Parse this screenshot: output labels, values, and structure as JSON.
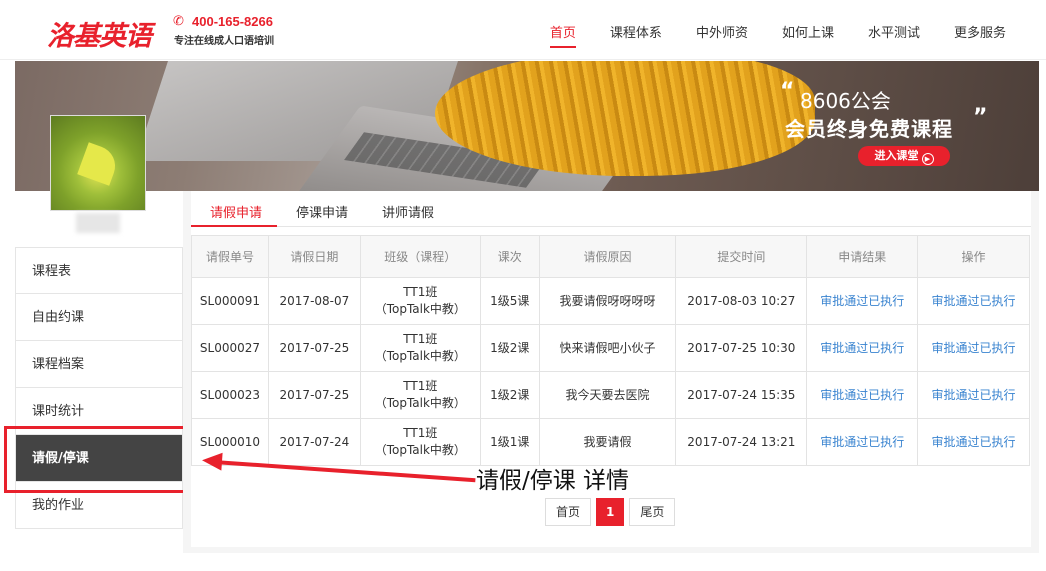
{
  "header": {
    "logo": "洛基英语",
    "phone": "400-165-8266",
    "slogan": "专注在线成人口语培训",
    "nav": [
      "首页",
      "课程体系",
      "中外师资",
      "如何上课",
      "水平测试",
      "更多服务"
    ],
    "nav_active": "首页"
  },
  "banner": {
    "line1": "8606公会",
    "line2": "会员终身免费课程",
    "open_quote": "“",
    "close_quote": "”",
    "button": "进入课堂"
  },
  "sidebar": {
    "items": [
      "课程表",
      "自由约课",
      "课程档案",
      "课时统计",
      "请假/停课",
      "我的作业"
    ],
    "active": "请假/停课"
  },
  "tabs": [
    "请假申请",
    "停课申请",
    "讲师请假"
  ],
  "table": {
    "headers": [
      "请假单号",
      "请假日期",
      "班级（课程）",
      "课次",
      "请假原因",
      "提交时间",
      "申请结果",
      "操作"
    ],
    "rows": [
      [
        "SL000091",
        "2017-08-07",
        "TT1班",
        "（TopTalk中教）",
        "1级5课",
        "我要请假呀呀呀呀",
        "2017-08-03 10:27",
        "审批通过已执行",
        "审批通过已执行"
      ],
      [
        "SL000027",
        "2017-07-25",
        "TT1班",
        "（TopTalk中教）",
        "1级2课",
        "快来请假吧小伙子",
        "2017-07-25 10:30",
        "审批通过已执行",
        "审批通过已执行"
      ],
      [
        "SL000023",
        "2017-07-25",
        "TT1班",
        "（TopTalk中教）",
        "1级2课",
        "我今天要去医院",
        "2017-07-24 15:35",
        "审批通过已执行",
        "审批通过已执行"
      ],
      [
        "SL000010",
        "2017-07-24",
        "TT1班",
        "（TopTalk中教）",
        "1级1课",
        "我要请假",
        "2017-07-24 13:21",
        "审批通过已执行",
        "审批通过已执行"
      ]
    ]
  },
  "pager": {
    "first": "首页",
    "current": "1",
    "last": "尾页"
  },
  "annotation": "请假/停课 详情",
  "colors": {
    "brand_red": "#e8212c",
    "link_blue": "#3a84d0",
    "sidebar_active": "#444444"
  }
}
